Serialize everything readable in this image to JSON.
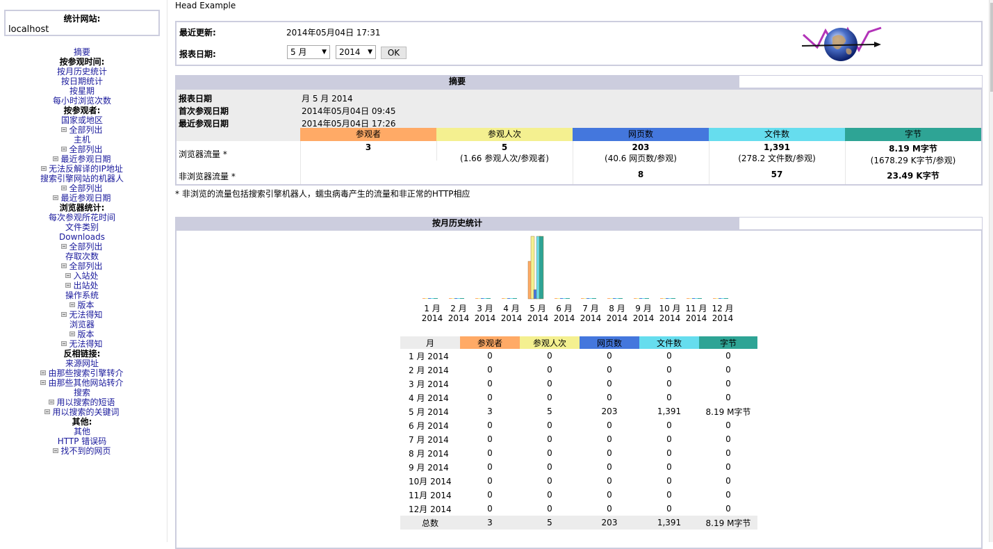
{
  "nav": {
    "site_title": "统计网站:",
    "site_value": "localhost",
    "items": [
      {
        "label": "摘要",
        "kind": "link"
      },
      {
        "label": "按参观时间:",
        "kind": "cat"
      },
      {
        "label": "按月历史统计",
        "kind": "link"
      },
      {
        "label": "按日期统计",
        "kind": "link"
      },
      {
        "label": "按星期",
        "kind": "link"
      },
      {
        "label": "每小时浏览次数",
        "kind": "link"
      },
      {
        "label": "按参观者:",
        "kind": "cat"
      },
      {
        "label": "国家或地区",
        "kind": "link"
      },
      {
        "label": "全部列出",
        "kind": "sub"
      },
      {
        "label": "主机",
        "kind": "link"
      },
      {
        "label": "全部列出",
        "kind": "sub"
      },
      {
        "label": "最近参观日期",
        "kind": "sub"
      },
      {
        "label": "无法反解译的IP地址",
        "kind": "sub"
      },
      {
        "label": "搜索引擎网站的机器人",
        "kind": "link"
      },
      {
        "label": "全部列出",
        "kind": "sub"
      },
      {
        "label": "最近参观日期",
        "kind": "sub"
      },
      {
        "label": "浏览器统计:",
        "kind": "cat"
      },
      {
        "label": "每次参观所花时间",
        "kind": "link"
      },
      {
        "label": "文件类别",
        "kind": "link"
      },
      {
        "label": "Downloads",
        "kind": "link"
      },
      {
        "label": "全部列出",
        "kind": "sub"
      },
      {
        "label": "存取次数",
        "kind": "link"
      },
      {
        "label": "全部列出",
        "kind": "sub"
      },
      {
        "label": "入站处",
        "kind": "sub"
      },
      {
        "label": "出站处",
        "kind": "sub"
      },
      {
        "label": "操作系统",
        "kind": "link"
      },
      {
        "label": "版本",
        "kind": "sub"
      },
      {
        "label": "无法得知",
        "kind": "sub"
      },
      {
        "label": "浏览器",
        "kind": "link"
      },
      {
        "label": "版本",
        "kind": "sub"
      },
      {
        "label": "无法得知",
        "kind": "sub"
      },
      {
        "label": "反相链接:",
        "kind": "cat"
      },
      {
        "label": "来源网址",
        "kind": "link"
      },
      {
        "label": "由那些搜索引擎转介",
        "kind": "sub"
      },
      {
        "label": "由那些其他网站转介",
        "kind": "sub"
      },
      {
        "label": "搜索",
        "kind": "link"
      },
      {
        "label": "用以搜索的短语",
        "kind": "sub"
      },
      {
        "label": "用以搜索的关键词",
        "kind": "sub"
      },
      {
        "label": "其他:",
        "kind": "cat"
      },
      {
        "label": "其他",
        "kind": "link"
      },
      {
        "label": "HTTP 错误码",
        "kind": "link"
      },
      {
        "label": "找不到的网页",
        "kind": "sub"
      }
    ]
  },
  "header": {
    "head_example": "Head Example",
    "last_update_label": "最近更新:",
    "last_update_value": "2014年05月04日 17:31",
    "report_date_label": "报表日期:",
    "month_select": "5 月",
    "year_select": "2014",
    "ok_label": "OK"
  },
  "colors": {
    "visitors": "#ffaa66",
    "visits": "#f4f090",
    "pages": "#4477dd",
    "hits": "#66ddee",
    "bytes": "#2ea495",
    "section": "#cccdde"
  },
  "summary": {
    "title": "摘要",
    "report_date_label": "报表日期",
    "report_date_value": "月 5 月 2014",
    "first_visit_label": "首次参观日期",
    "first_visit_value": "2014年05月04日 09:45",
    "last_visit_label": "最近参观日期",
    "last_visit_value": "2014年05月04日 17:26",
    "columns": [
      "参观者",
      "参观人次",
      "网页数",
      "文件数",
      "字节"
    ],
    "viewed_label": "浏览器流量 *",
    "not_viewed_label": "非浏览器流量 *",
    "viewed": {
      "visitors": "3",
      "visits": "5",
      "visits_sub": "(1.66 参观人次/参观者)",
      "pages": "203",
      "pages_sub": "(40.6 网页数/参观)",
      "hits": "1,391",
      "hits_sub": "(278.2 文件数/参观)",
      "bytes": "8.19 M字节",
      "bytes_sub": "(1678.29 K字节/参观)"
    },
    "not_viewed": {
      "pages": "8",
      "hits": "57",
      "bytes": "23.49 K字节"
    },
    "note": "* 非浏览的流量包括搜索引擎机器人，蠕虫病毒产生的流量和非正常的HTTP相应"
  },
  "monthly": {
    "title": "按月历史统计",
    "columns": [
      "月",
      "参观者",
      "参观人次",
      "网页数",
      "文件数",
      "字节"
    ],
    "rows": [
      [
        "1 月 2014",
        "0",
        "0",
        "0",
        "0",
        "0"
      ],
      [
        "2 月 2014",
        "0",
        "0",
        "0",
        "0",
        "0"
      ],
      [
        "3 月 2014",
        "0",
        "0",
        "0",
        "0",
        "0"
      ],
      [
        "4 月 2014",
        "0",
        "0",
        "0",
        "0",
        "0"
      ],
      [
        "5 月 2014",
        "3",
        "5",
        "203",
        "1,391",
        "8.19 M字节"
      ],
      [
        "6 月 2014",
        "0",
        "0",
        "0",
        "0",
        "0"
      ],
      [
        "7 月 2014",
        "0",
        "0",
        "0",
        "0",
        "0"
      ],
      [
        "8 月 2014",
        "0",
        "0",
        "0",
        "0",
        "0"
      ],
      [
        "9 月 2014",
        "0",
        "0",
        "0",
        "0",
        "0"
      ],
      [
        "10月 2014",
        "0",
        "0",
        "0",
        "0",
        "0"
      ],
      [
        "11月 2014",
        "0",
        "0",
        "0",
        "0",
        "0"
      ],
      [
        "12月 2014",
        "0",
        "0",
        "0",
        "0",
        "0"
      ]
    ],
    "total": [
      "总数",
      "3",
      "5",
      "203",
      "1,391",
      "8.19 M字节"
    ]
  },
  "chart_data": {
    "type": "bar",
    "categories": [
      "1 月\n2014",
      "2 月\n2014",
      "3 月\n2014",
      "4 月\n2014",
      "5 月\n2014",
      "6 月\n2014",
      "7 月\n2014",
      "8 月\n2014",
      "9 月\n2014",
      "10 月\n2014",
      "11 月\n2014",
      "12 月\n2014"
    ],
    "series": [
      {
        "name": "参观者",
        "values": [
          0,
          0,
          0,
          0,
          3,
          0,
          0,
          0,
          0,
          0,
          0,
          0
        ]
      },
      {
        "name": "参观人次",
        "values": [
          0,
          0,
          0,
          0,
          5,
          0,
          0,
          0,
          0,
          0,
          0,
          0
        ]
      },
      {
        "name": "网页数",
        "values": [
          0,
          0,
          0,
          0,
          203,
          0,
          0,
          0,
          0,
          0,
          0,
          0
        ]
      },
      {
        "name": "文件数",
        "values": [
          0,
          0,
          0,
          0,
          1391,
          0,
          0,
          0,
          0,
          0,
          0,
          0
        ]
      },
      {
        "name": "字节",
        "values": [
          0,
          0,
          0,
          0,
          8.19,
          0,
          0,
          0,
          0,
          0,
          0,
          0
        ]
      }
    ]
  }
}
